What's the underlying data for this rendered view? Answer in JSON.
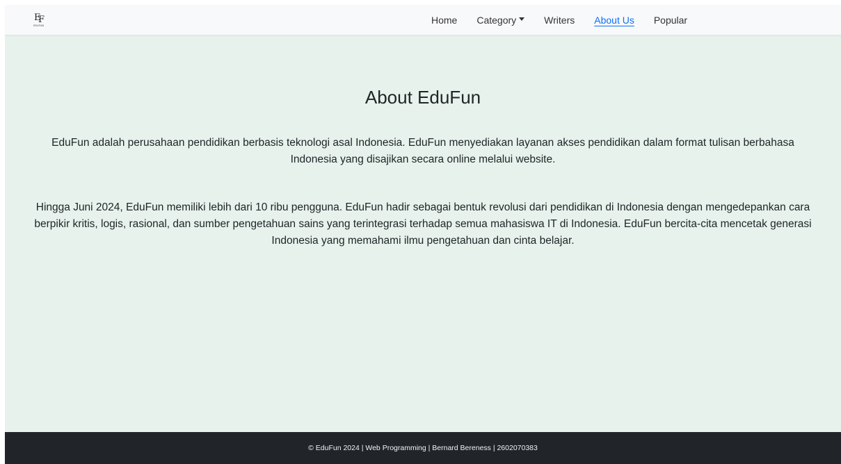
{
  "navbar": {
    "logo_text": "EF",
    "logo_subtext": "EDUFUN",
    "links": [
      {
        "label": "Home"
      },
      {
        "label": "Category"
      },
      {
        "label": "Writers"
      },
      {
        "label": "About Us"
      },
      {
        "label": "Popular"
      }
    ],
    "active_link": "About Us"
  },
  "main": {
    "title": "About EduFun",
    "paragraph_1": "EduFun adalah perusahaan pendidikan berbasis teknologi asal Indonesia. EduFun menyediakan layanan akses pendidikan dalam format tulisan berbahasa Indonesia yang disajikan secara online melalui website.",
    "paragraph_2": "Hingga Juni 2024, EduFun memiliki lebih dari 10 ribu pengguna. EduFun hadir sebagai bentuk revolusi dari pendidikan di Indonesia dengan mengedepankan cara berpikir kritis, logis, rasional, dan sumber pengetahuan sains yang terintegrasi terhadap semua mahasiswa IT di Indonesia. EduFun bercita-cita mencetak generasi Indonesia yang memahami ilmu pengetahuan dan cinta belajar."
  },
  "footer": {
    "text": "© EduFun 2024 | Web Programming | Bernard Bereness | 2602070383"
  },
  "colors": {
    "page_background": "#e7f2ec",
    "navbar_background": "#f8f9fa",
    "footer_background": "#212529",
    "active_link": "#0d6efd",
    "text": "#212529"
  },
  "icons": {
    "logo": "edufun-logo",
    "category_dropdown": "caret-down-icon"
  }
}
